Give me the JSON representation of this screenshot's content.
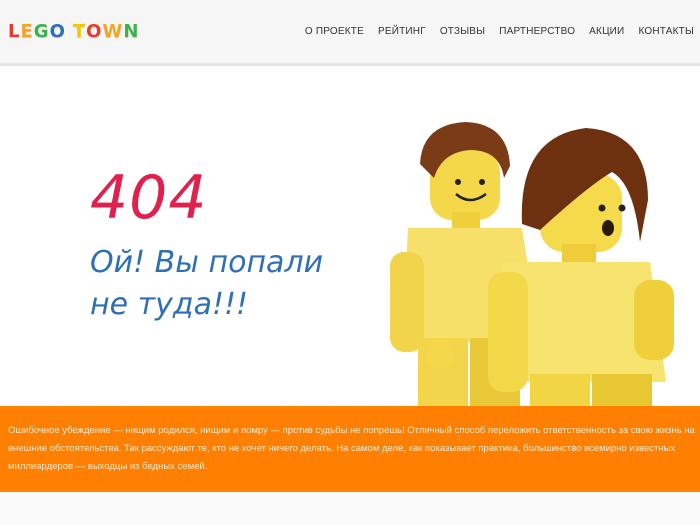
{
  "header": {
    "logo": {
      "text": "LEGO TOWN",
      "letters": [
        {
          "ch": "L",
          "color": "#e63b2e"
        },
        {
          "ch": "E",
          "color": "#f5a623"
        },
        {
          "ch": "G",
          "color": "#3bb34a"
        },
        {
          "ch": "O",
          "color": "#2f6fb4"
        },
        {
          "ch": "T",
          "color": "#f5c800"
        },
        {
          "ch": "O",
          "color": "#e63b2e"
        },
        {
          "ch": "W",
          "color": "#f5a623"
        },
        {
          "ch": "N",
          "color": "#3bb34a"
        }
      ]
    },
    "nav": [
      "О ПРОЕКТЕ",
      "РЕЙТИНГ",
      "ОТЗЫВЫ",
      "ПАРТНЕРСТВО",
      "АКЦИИ",
      "КОНТАКТЫ"
    ]
  },
  "main": {
    "error_code": "404",
    "message_line1": "Ой! Вы попали",
    "message_line2": "не туда!!!"
  },
  "banner": {
    "text": "Ошибочное убеждение — нищим родился, нищим и помру — против судьбы не попрешь! Отличный способ переложить ответственность за свою жизнь на внешние обстоятельства. Так рассуждают те, кто не хочет ничего делать. На самом деле, как показывает практика, большинство всемирно известных миллиардеров — выходцы из бедных семей."
  },
  "colors": {
    "accent_red": "#e0204d",
    "accent_blue": "#2f6fb4",
    "banner_orange": "#ff7f00"
  }
}
